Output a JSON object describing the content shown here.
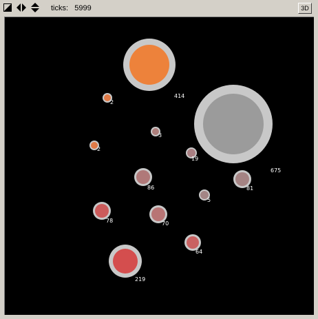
{
  "toolbar": {
    "ticks_label": "ticks:",
    "ticks_value": "5999",
    "btn_3d_label": "3D",
    "icons": [
      "pin-icon",
      "horizontal-arrows-icon",
      "vertical-arrows-icon"
    ]
  },
  "colors": {
    "background": "#000000",
    "ring": "#c8c8c8",
    "label": "#ffffff"
  },
  "nodes": [
    {
      "label": "414",
      "color": "#ed823b"
    },
    {
      "label": "675",
      "color": "#9b9b9b"
    },
    {
      "label": "2",
      "color": "#e07a47"
    },
    {
      "label": "3",
      "color": "#ad7f7c"
    },
    {
      "label": "2",
      "color": "#e07a47"
    },
    {
      "label": "19",
      "color": "#a97f82"
    },
    {
      "label": "86",
      "color": "#b07979"
    },
    {
      "label": "81",
      "color": "#a48383"
    },
    {
      "label": "5",
      "color": "#a38585"
    },
    {
      "label": "78",
      "color": "#cc5b5b"
    },
    {
      "label": "70",
      "color": "#b87575"
    },
    {
      "label": "64",
      "color": "#c96262"
    },
    {
      "label": "219",
      "color": "#d44e4e"
    }
  ]
}
